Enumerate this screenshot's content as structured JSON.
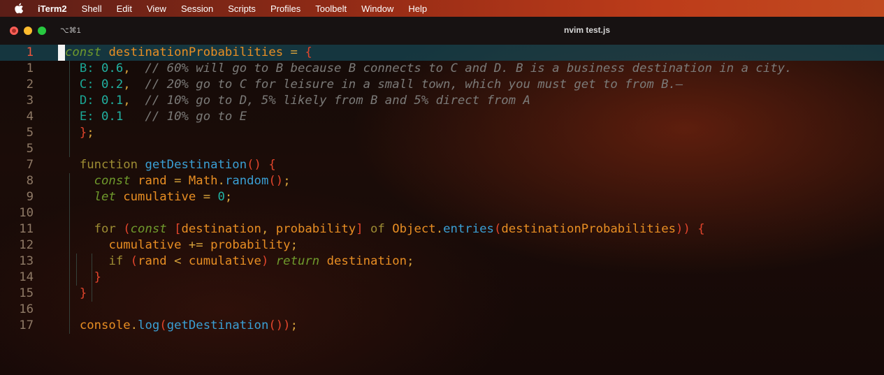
{
  "menubar": {
    "app_name": "iTerm2",
    "items": [
      "Shell",
      "Edit",
      "View",
      "Session",
      "Scripts",
      "Profiles",
      "Toolbelt",
      "Window",
      "Help"
    ]
  },
  "window": {
    "tab_shortcut": "⌥⌘1",
    "title": "nvim test.js"
  },
  "editor": {
    "current_line": 1,
    "lines": [
      {
        "number": "1",
        "current": true,
        "tokens": [
          {
            "t": "const",
            "c": "kw"
          },
          {
            "t": " ",
            "c": "pl"
          },
          {
            "t": "destinationProbabilities",
            "c": "id"
          },
          {
            "t": " = ",
            "c": "op"
          },
          {
            "t": "{",
            "c": "br"
          }
        ]
      },
      {
        "number": "1",
        "tokens": [
          {
            "t": "  ",
            "c": "pl"
          },
          {
            "t": "B:",
            "c": "key"
          },
          {
            "t": " ",
            "c": "pl"
          },
          {
            "t": "0.6",
            "c": "num"
          },
          {
            "t": ",  ",
            "c": "op"
          },
          {
            "t": "// 60% will go to B because B connects to C and D. B is a business destination in a city.",
            "c": "cm"
          }
        ]
      },
      {
        "number": "2",
        "tokens": [
          {
            "t": "  ",
            "c": "pl"
          },
          {
            "t": "C:",
            "c": "key"
          },
          {
            "t": " ",
            "c": "pl"
          },
          {
            "t": "0.2",
            "c": "num"
          },
          {
            "t": ",  ",
            "c": "op"
          },
          {
            "t": "// 20% go to C for leisure in a small town, which you must get to from B.—",
            "c": "cm"
          }
        ]
      },
      {
        "number": "3",
        "tokens": [
          {
            "t": "  ",
            "c": "pl"
          },
          {
            "t": "D:",
            "c": "key"
          },
          {
            "t": " ",
            "c": "pl"
          },
          {
            "t": "0.1",
            "c": "num"
          },
          {
            "t": ",  ",
            "c": "op"
          },
          {
            "t": "// 10% go to D, 5% likely from B and 5% direct from A",
            "c": "cm"
          }
        ]
      },
      {
        "number": "4",
        "tokens": [
          {
            "t": "  ",
            "c": "pl"
          },
          {
            "t": "E:",
            "c": "key"
          },
          {
            "t": " ",
            "c": "pl"
          },
          {
            "t": "0.1",
            "c": "num"
          },
          {
            "t": "   ",
            "c": "pl"
          },
          {
            "t": "// 10% go to E",
            "c": "cm"
          }
        ]
      },
      {
        "number": "5",
        "tokens": [
          {
            "t": "  ",
            "c": "pl"
          },
          {
            "t": "}",
            "c": "br"
          },
          {
            "t": ";",
            "c": "op"
          }
        ]
      },
      {
        "number": "5",
        "tokens": []
      },
      {
        "number": "7",
        "tokens": [
          {
            "t": "  ",
            "c": "pl"
          },
          {
            "t": "function",
            "c": "kw2"
          },
          {
            "t": " ",
            "c": "pl"
          },
          {
            "t": "getDestination",
            "c": "fn"
          },
          {
            "t": "()",
            "c": "br"
          },
          {
            "t": " ",
            "c": "pl"
          },
          {
            "t": "{",
            "c": "br"
          }
        ]
      },
      {
        "number": "8",
        "tokens": [
          {
            "t": "    ",
            "c": "pl"
          },
          {
            "t": "const",
            "c": "kw"
          },
          {
            "t": " ",
            "c": "pl"
          },
          {
            "t": "rand",
            "c": "id"
          },
          {
            "t": " = ",
            "c": "op"
          },
          {
            "t": "Math",
            "c": "id"
          },
          {
            "t": ".",
            "c": "op"
          },
          {
            "t": "random",
            "c": "fn"
          },
          {
            "t": "()",
            "c": "br"
          },
          {
            "t": ";",
            "c": "op"
          }
        ]
      },
      {
        "number": "9",
        "tokens": [
          {
            "t": "    ",
            "c": "pl"
          },
          {
            "t": "let",
            "c": "kw"
          },
          {
            "t": " ",
            "c": "pl"
          },
          {
            "t": "cumulative",
            "c": "id"
          },
          {
            "t": " = ",
            "c": "op"
          },
          {
            "t": "0",
            "c": "num"
          },
          {
            "t": ";",
            "c": "op"
          }
        ]
      },
      {
        "number": "10",
        "tokens": []
      },
      {
        "number": "11",
        "tokens": [
          {
            "t": "    ",
            "c": "pl"
          },
          {
            "t": "for",
            "c": "kw2"
          },
          {
            "t": " ",
            "c": "pl"
          },
          {
            "t": "(",
            "c": "br"
          },
          {
            "t": "const",
            "c": "kw"
          },
          {
            "t": " ",
            "c": "pl"
          },
          {
            "t": "[",
            "c": "br"
          },
          {
            "t": "destination",
            "c": "id"
          },
          {
            "t": ", ",
            "c": "op"
          },
          {
            "t": "probability",
            "c": "id"
          },
          {
            "t": "]",
            "c": "br"
          },
          {
            "t": " of ",
            "c": "kw2"
          },
          {
            "t": "Object",
            "c": "id"
          },
          {
            "t": ".",
            "c": "op"
          },
          {
            "t": "entries",
            "c": "fn"
          },
          {
            "t": "(",
            "c": "br"
          },
          {
            "t": "destinationProbabilities",
            "c": "id"
          },
          {
            "t": "))",
            "c": "br"
          },
          {
            "t": " ",
            "c": "pl"
          },
          {
            "t": "{",
            "c": "br"
          }
        ]
      },
      {
        "number": "12",
        "tokens": [
          {
            "t": "      ",
            "c": "pl"
          },
          {
            "t": "cumulative",
            "c": "id"
          },
          {
            "t": " += ",
            "c": "op"
          },
          {
            "t": "probability",
            "c": "id"
          },
          {
            "t": ";",
            "c": "op"
          }
        ]
      },
      {
        "number": "13",
        "tokens": [
          {
            "t": "      ",
            "c": "pl"
          },
          {
            "t": "if",
            "c": "kw2"
          },
          {
            "t": " ",
            "c": "pl"
          },
          {
            "t": "(",
            "c": "br"
          },
          {
            "t": "rand",
            "c": "id"
          },
          {
            "t": " < ",
            "c": "op"
          },
          {
            "t": "cumulative",
            "c": "id"
          },
          {
            "t": ")",
            "c": "br"
          },
          {
            "t": " ",
            "c": "pl"
          },
          {
            "t": "return",
            "c": "kw"
          },
          {
            "t": " ",
            "c": "pl"
          },
          {
            "t": "destination",
            "c": "id"
          },
          {
            "t": ";",
            "c": "op"
          }
        ]
      },
      {
        "number": "14",
        "tokens": [
          {
            "t": "    ",
            "c": "pl"
          },
          {
            "t": "}",
            "c": "br"
          }
        ]
      },
      {
        "number": "15",
        "tokens": [
          {
            "t": "  ",
            "c": "pl"
          },
          {
            "t": "}",
            "c": "br"
          }
        ]
      },
      {
        "number": "16",
        "tokens": []
      },
      {
        "number": "17",
        "tokens": [
          {
            "t": "  ",
            "c": "pl"
          },
          {
            "t": "console",
            "c": "id"
          },
          {
            "t": ".",
            "c": "op"
          },
          {
            "t": "log",
            "c": "fn"
          },
          {
            "t": "(",
            "c": "br"
          },
          {
            "t": "getDestination",
            "c": "fn"
          },
          {
            "t": "())",
            "c": "br"
          },
          {
            "t": ";",
            "c": "op"
          }
        ]
      }
    ]
  }
}
